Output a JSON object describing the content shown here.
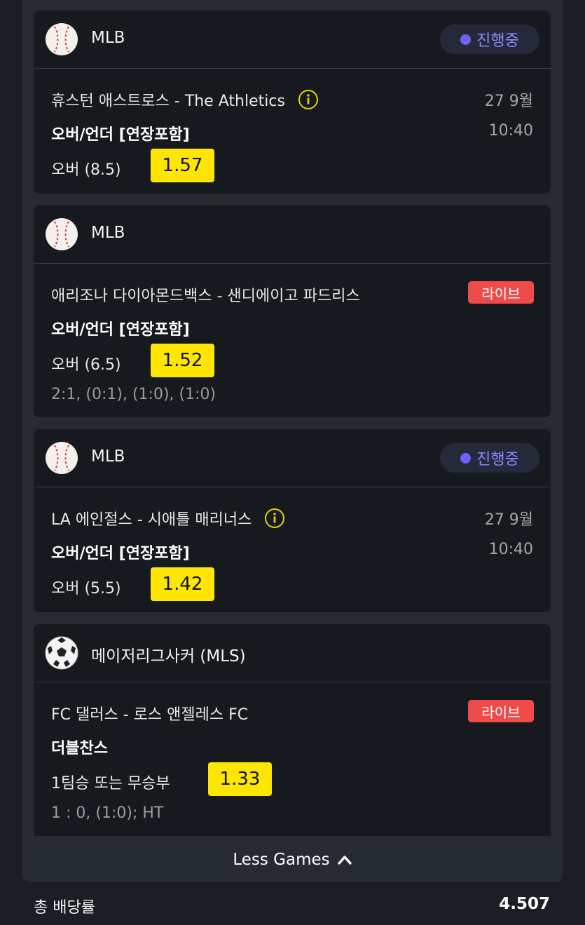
{
  "bets": [
    {
      "league": "MLB",
      "sport_icon": "baseball-icon",
      "status": "진행중",
      "match": "휴스턴 애스트로스 - The Athletics",
      "date": "27 9월",
      "time": "10:40",
      "market": "오버/언더 [연장포함]",
      "pick": "오버 (8.5)",
      "odds": "1.57"
    },
    {
      "league": "MLB",
      "sport_icon": "baseball-icon",
      "live": "라이브",
      "match": "애리조나 다이아몬드백스 - 샌디에이고 파드리스",
      "market": "오버/언더 [연장포함]",
      "pick": "오버 (6.5)",
      "odds": "1.52",
      "score": "2:1, (0:1), (1:0), (1:0)"
    },
    {
      "league": "MLB",
      "sport_icon": "baseball-icon",
      "status": "진행중",
      "match": "LA 에인절스 - 시애틀 매리너스",
      "date": "27 9월",
      "time": "10:40",
      "market": "오버/언더 [연장포함]",
      "pick": "오버 (5.5)",
      "odds": "1.42"
    },
    {
      "league": "메이저리그사커 (MLS)",
      "sport_icon": "soccer-ball-icon",
      "live": "라이브",
      "match": "FC 댈러스 - 로스 앤젤레스 FC",
      "market": "더블찬스",
      "pick": "1팀승 또는 무승부",
      "odds": "1.33",
      "score": "1 : 0, (1:0); HT"
    }
  ],
  "less_games_label": "Less Games",
  "total_label": "총 배당률",
  "total_value": "4.507",
  "colors": {
    "odds_bg": "#ffe600",
    "live_bg": "#f04b4b",
    "status_text": "#8f86ff"
  }
}
